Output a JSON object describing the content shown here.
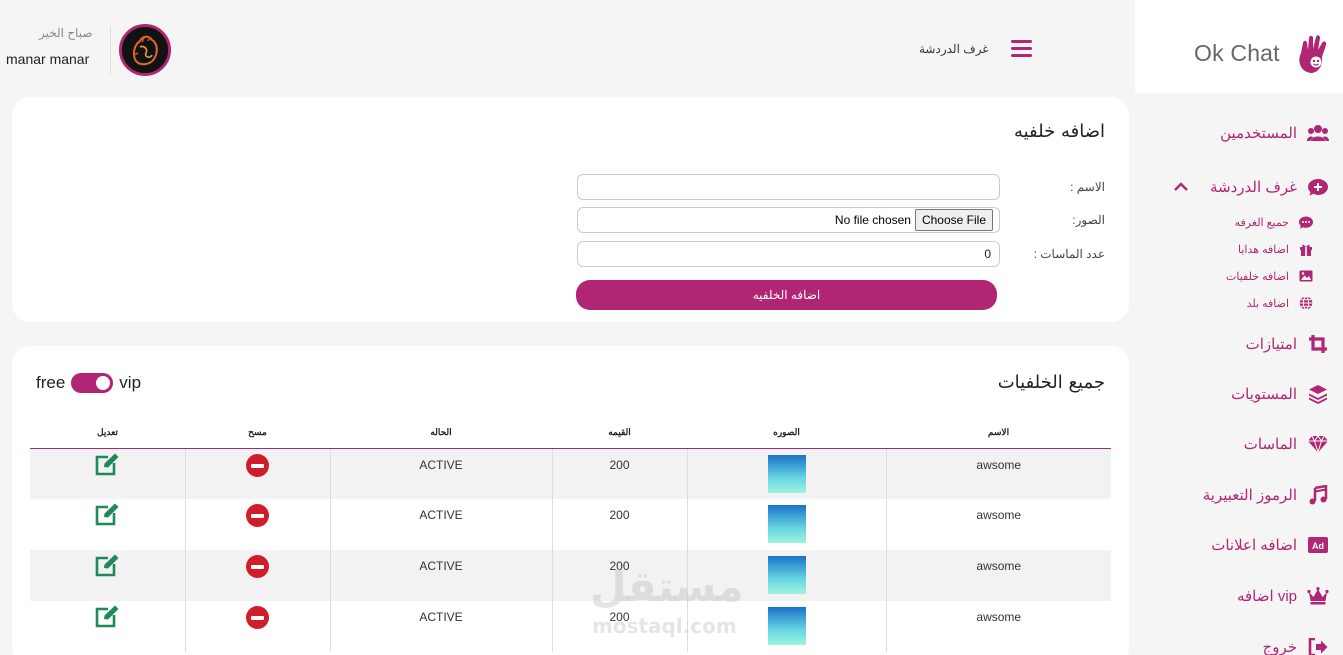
{
  "brand": {
    "name": "Ok Chat"
  },
  "header": {
    "title": "غرف الدردشة",
    "greeting": "صباح الخير",
    "username": "manar manar"
  },
  "sidebar": {
    "items": [
      {
        "label": "المستخدمين",
        "icon": "users-icon"
      },
      {
        "label": "غرف الدردشة",
        "icon": "chat-plus-icon",
        "expanded": true
      },
      {
        "label": "امتيازات",
        "icon": "crop-icon"
      },
      {
        "label": "المستويات",
        "icon": "layers-icon"
      },
      {
        "label": "الماسات",
        "icon": "diamond-icon"
      },
      {
        "label": "الرموز التعبيرية",
        "icon": "music-icon"
      },
      {
        "label": "اضافه اعلانات",
        "icon": "ad-icon"
      },
      {
        "label": "vip اضافه",
        "icon": "crown-icon"
      },
      {
        "label": "خروج",
        "icon": "logout-icon"
      }
    ],
    "subitems": [
      {
        "label": "جميع الغرفه",
        "icon": "comment-icon"
      },
      {
        "label": "اضافه هدايا",
        "icon": "gift-icon"
      },
      {
        "label": "اضافه خلفيات",
        "icon": "image-icon"
      },
      {
        "label": "اضافه بلد",
        "icon": "globe-icon"
      }
    ]
  },
  "add_form": {
    "title": "اضافه خلفيه",
    "name_label": "الاسم :",
    "name_value": "",
    "image_label": "الصور:",
    "file_button": "Choose File",
    "file_status": "No file chosen",
    "diamonds_label": "عدد الماسات :",
    "diamonds_value": "0",
    "submit_label": "اضافه الخلفيه"
  },
  "list": {
    "title": "جميع الخلفيات",
    "toggle_left": "free",
    "toggle_right": "vip",
    "toggle_on": true,
    "columns": [
      "الاسم",
      "الصوره",
      "القيمه",
      "الحاله",
      "مسح",
      "تعديل"
    ],
    "rows": [
      {
        "name": "awsome",
        "value": "200",
        "status": "ACTIVE"
      },
      {
        "name": "awsome",
        "value": "200",
        "status": "ACTIVE"
      },
      {
        "name": "awsome",
        "value": "200",
        "status": "ACTIVE"
      },
      {
        "name": "awsome",
        "value": "200",
        "status": "ACTIVE"
      }
    ]
  },
  "watermark": {
    "arabic": "مستقل",
    "latin": "mostaql.com"
  },
  "colors": {
    "accent": "#b02574",
    "delete": "#d11d2b",
    "edit": "#1e8a5a"
  }
}
